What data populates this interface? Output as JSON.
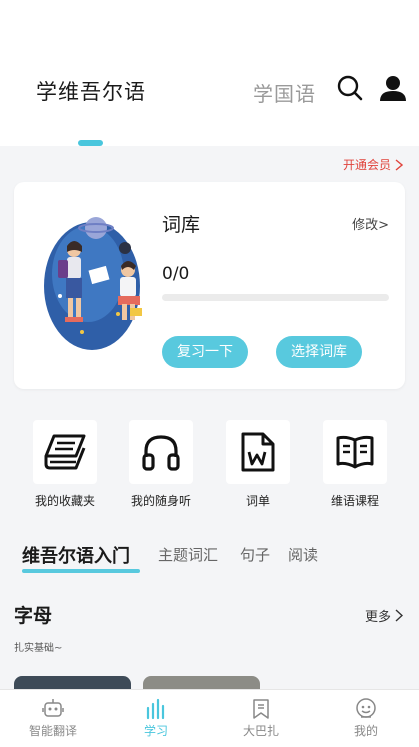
{
  "header": {
    "tab_active": "学维吾尔语",
    "tab_other": "学国语"
  },
  "vip": {
    "label": "开通会员"
  },
  "vocab_card": {
    "title": "词库",
    "edit_label": "修改>",
    "progress_text": "0/0",
    "progress_fraction": 0,
    "review_button": "复习一下",
    "select_button": "选择词库"
  },
  "shortcuts": [
    {
      "label": "我的收藏夹",
      "icon": "book-stack-icon"
    },
    {
      "label": "我的随身听",
      "icon": "headphones-icon"
    },
    {
      "label": "词单",
      "icon": "word-file-icon"
    },
    {
      "label": "维语课程",
      "icon": "open-book-icon"
    }
  ],
  "subtabs": [
    {
      "label": "维吾尔语入门",
      "active": true
    },
    {
      "label": "主题词汇",
      "active": false
    },
    {
      "label": "句子",
      "active": false
    },
    {
      "label": "阅读",
      "active": false
    }
  ],
  "section": {
    "title": "字母",
    "more_label": "更多",
    "subtitle": "扎实基础~"
  },
  "bottom_nav": [
    {
      "label": "智能翻译",
      "icon": "robot-icon",
      "active": false
    },
    {
      "label": "学习",
      "icon": "bars-icon",
      "active": true
    },
    {
      "label": "大巴扎",
      "icon": "bookmark-icon",
      "active": false
    },
    {
      "label": "我的",
      "icon": "smiley-icon",
      "active": false
    }
  ],
  "colors": {
    "accent": "#49c6dd",
    "vip_red": "#e0443c"
  }
}
